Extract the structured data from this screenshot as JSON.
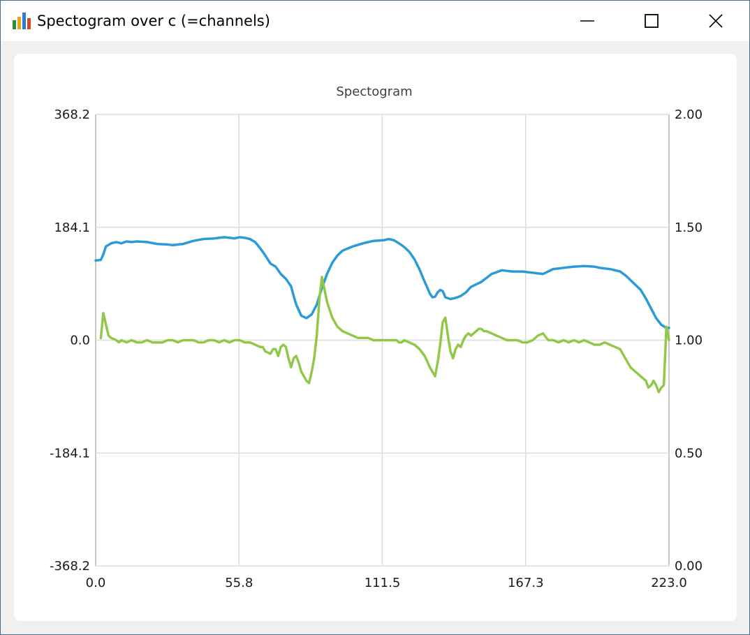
{
  "window": {
    "title": "Spectogram over c (=channels)",
    "icon": "bar-chart-icon",
    "controls": [
      "minimize-icon",
      "maximize-icon",
      "close-icon"
    ]
  },
  "chart_data": {
    "type": "line",
    "title": "Spectogram",
    "xlabel": "",
    "ylabel": "",
    "xlim": [
      0,
      223
    ],
    "ylim": [
      -368.2,
      368.2
    ],
    "ylim_right": [
      0,
      2
    ],
    "x_ticks": [
      "0.0",
      "55.8",
      "111.5",
      "167.3",
      "223.0"
    ],
    "y_ticks_left": [
      "-368.2",
      "-184.1",
      "0.0",
      "184.1",
      "368.2"
    ],
    "y_ticks_right": [
      "0.00",
      "0.50",
      "1.00",
      "1.50",
      "2.00"
    ],
    "grid": true,
    "legend": "none",
    "series": [
      {
        "color": "#2b9bd8",
        "axis": "left",
        "x": [
          0,
          2,
          3,
          4,
          6,
          8,
          10,
          12,
          14,
          16,
          20,
          24,
          28,
          30,
          34,
          38,
          42,
          46,
          50,
          54,
          56,
          58,
          60,
          62,
          64,
          66,
          68,
          70,
          72,
          74,
          76,
          77,
          78,
          80,
          82,
          84,
          86,
          88,
          90,
          92,
          94,
          96,
          100,
          104,
          108,
          112,
          114,
          116,
          118,
          120,
          122,
          124,
          126,
          128,
          130,
          131,
          132,
          133,
          134,
          135,
          136,
          138,
          140,
          142,
          144,
          146,
          150,
          154,
          158,
          162,
          166,
          170,
          172,
          174,
          176,
          178,
          182,
          186,
          190,
          194,
          196,
          200,
          204,
          206,
          208,
          210,
          212,
          214,
          216,
          218,
          220,
          222,
          223
        ],
        "y": [
          130,
          131,
          140,
          153,
          158,
          160,
          158,
          161,
          160,
          161,
          160,
          157,
          156,
          155,
          157,
          162,
          165,
          166,
          168,
          166,
          168,
          167,
          165,
          160,
          150,
          138,
          125,
          120,
          108,
          100,
          88,
          72,
          58,
          40,
          36,
          42,
          58,
          85,
          108,
          126,
          138,
          146,
          153,
          158,
          162,
          163,
          165,
          163,
          158,
          152,
          144,
          132,
          115,
          95,
          76,
          70,
          71,
          78,
          82,
          80,
          70,
          67,
          69,
          72,
          78,
          87,
          95,
          108,
          114,
          112,
          112,
          110,
          109,
          108,
          112,
          116,
          118,
          120,
          121,
          120,
          118,
          116,
          112,
          106,
          98,
          90,
          82,
          68,
          52,
          36,
          25,
          20,
          20
        ]
      },
      {
        "color": "#92c84a",
        "axis": "right",
        "x": [
          2,
          3,
          4,
          5,
          6,
          8,
          9,
          10,
          12,
          14,
          16,
          18,
          20,
          22,
          24,
          26,
          28,
          30,
          32,
          34,
          36,
          38,
          40,
          42,
          44,
          46,
          48,
          50,
          52,
          54,
          56,
          58,
          60,
          62,
          64,
          65,
          66,
          68,
          69,
          70,
          71,
          72,
          73,
          74,
          75,
          76,
          77,
          78,
          79,
          80,
          81,
          82,
          83,
          84,
          85,
          86,
          87,
          88,
          90,
          92,
          94,
          96,
          98,
          100,
          102,
          104,
          106,
          108,
          110,
          112,
          114,
          116,
          117,
          118,
          119,
          120,
          122,
          124,
          126,
          128,
          130,
          131,
          132,
          133,
          134,
          135,
          136,
          137,
          138,
          139,
          140,
          141,
          142,
          143,
          144,
          145,
          146,
          147,
          148,
          149,
          150,
          151,
          152,
          154,
          156,
          158,
          160,
          162,
          164,
          166,
          168,
          170,
          172,
          174,
          176,
          178,
          180,
          182,
          184,
          186,
          188,
          190,
          192,
          194,
          196,
          198,
          200,
          202,
          204,
          206,
          208,
          210,
          212,
          214,
          215,
          216,
          217,
          218,
          219,
          220,
          221,
          222,
          223
        ],
        "y": [
          1.01,
          1.12,
          1.07,
          1.02,
          1.01,
          1.0,
          0.99,
          1.0,
          0.99,
          1.0,
          0.99,
          0.99,
          1.0,
          0.99,
          0.99,
          0.99,
          1.0,
          1.0,
          0.99,
          1.0,
          1.0,
          1.0,
          0.99,
          0.99,
          1.0,
          1.0,
          0.99,
          1.0,
          0.99,
          1.0,
          1.0,
          0.99,
          0.99,
          0.98,
          0.97,
          0.97,
          0.95,
          0.94,
          0.96,
          0.96,
          0.93,
          0.97,
          0.98,
          0.97,
          0.92,
          0.88,
          0.92,
          0.93,
          0.9,
          0.86,
          0.84,
          0.82,
          0.81,
          0.86,
          0.92,
          1.02,
          1.18,
          1.28,
          1.17,
          1.1,
          1.06,
          1.04,
          1.03,
          1.02,
          1.01,
          1.01,
          1.01,
          1.0,
          1.0,
          1.0,
          1.0,
          1.0,
          1.0,
          0.99,
          0.99,
          1.0,
          0.99,
          0.98,
          0.96,
          0.93,
          0.88,
          0.86,
          0.84,
          0.9,
          0.98,
          1.08,
          1.1,
          1.02,
          0.95,
          0.92,
          0.96,
          0.98,
          0.97,
          1.0,
          1.02,
          1.03,
          1.02,
          1.03,
          1.04,
          1.05,
          1.05,
          1.04,
          1.04,
          1.03,
          1.02,
          1.01,
          1.0,
          1.0,
          1.0,
          0.99,
          0.99,
          1.0,
          1.02,
          1.03,
          1.0,
          1.0,
          0.99,
          1.0,
          0.99,
          1.0,
          0.99,
          1.0,
          0.99,
          0.98,
          0.98,
          0.99,
          0.98,
          0.97,
          0.96,
          0.92,
          0.88,
          0.86,
          0.84,
          0.82,
          0.79,
          0.8,
          0.82,
          0.8,
          0.77,
          0.79,
          0.8,
          1.06,
          1.0
        ]
      }
    ]
  }
}
